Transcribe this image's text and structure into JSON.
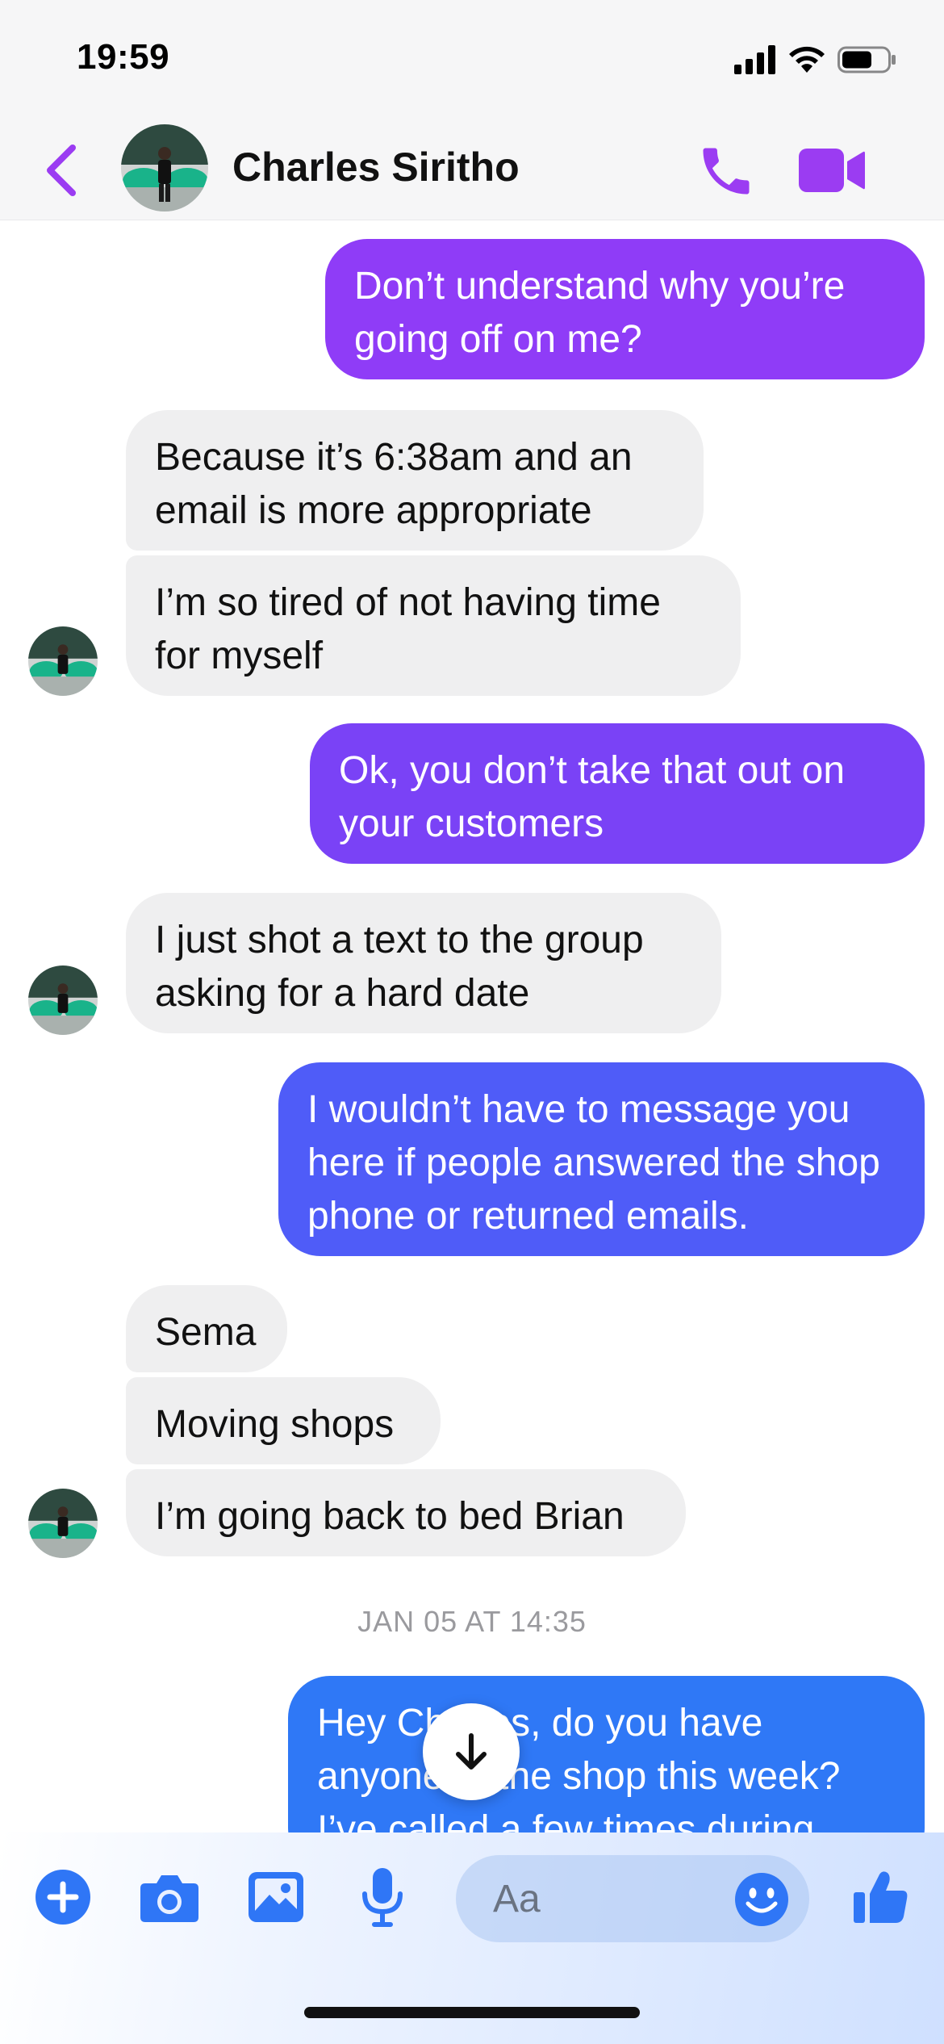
{
  "status_bar": {
    "time": "19:59"
  },
  "header": {
    "contact_name": "Charles Siritho"
  },
  "messages": [
    {
      "dir": "out",
      "text": "Don’t understand why you’re going off on me?"
    },
    {
      "dir": "in",
      "text": "Because it’s 6:38am and an email is more appropriate"
    },
    {
      "dir": "in",
      "text": "I’m so tired of not having time for myself"
    },
    {
      "dir": "out",
      "text": "Ok, you don’t take that out on your customers"
    },
    {
      "dir": "in",
      "text": "I just shot a text to the group asking for a hard date"
    },
    {
      "dir": "out",
      "text": "I wouldn’t have to message you here if people answered the shop phone or returned emails."
    },
    {
      "dir": "in",
      "text": "Sema"
    },
    {
      "dir": "in",
      "text": "Moving shops"
    },
    {
      "dir": "in",
      "text": "I’m going back to bed Brian"
    },
    {
      "dir": "out",
      "text": "Hey Charles, do you have anyone at the shop this week? I’ve called a few times during"
    }
  ],
  "timestamp": "JAN 05 AT 14:35",
  "composer": {
    "placeholder": "Aa"
  },
  "colors": {
    "accent": "#9b3cf2",
    "bubble_incoming": "#efeff0",
    "bubble_out_1": "#8f3cf7",
    "bubble_out_2": "#7a42f6",
    "bubble_out_3": "#4f5cf8",
    "bubble_out_4": "#2f78f6",
    "composer_icon": "#2f76f6"
  },
  "icons": [
    "chevron-left-icon",
    "phone-icon",
    "video-camera-icon",
    "plus-icon",
    "camera-icon",
    "image-icon",
    "microphone-icon",
    "emoji-icon",
    "thumbs-up-icon",
    "arrow-down-icon"
  ]
}
